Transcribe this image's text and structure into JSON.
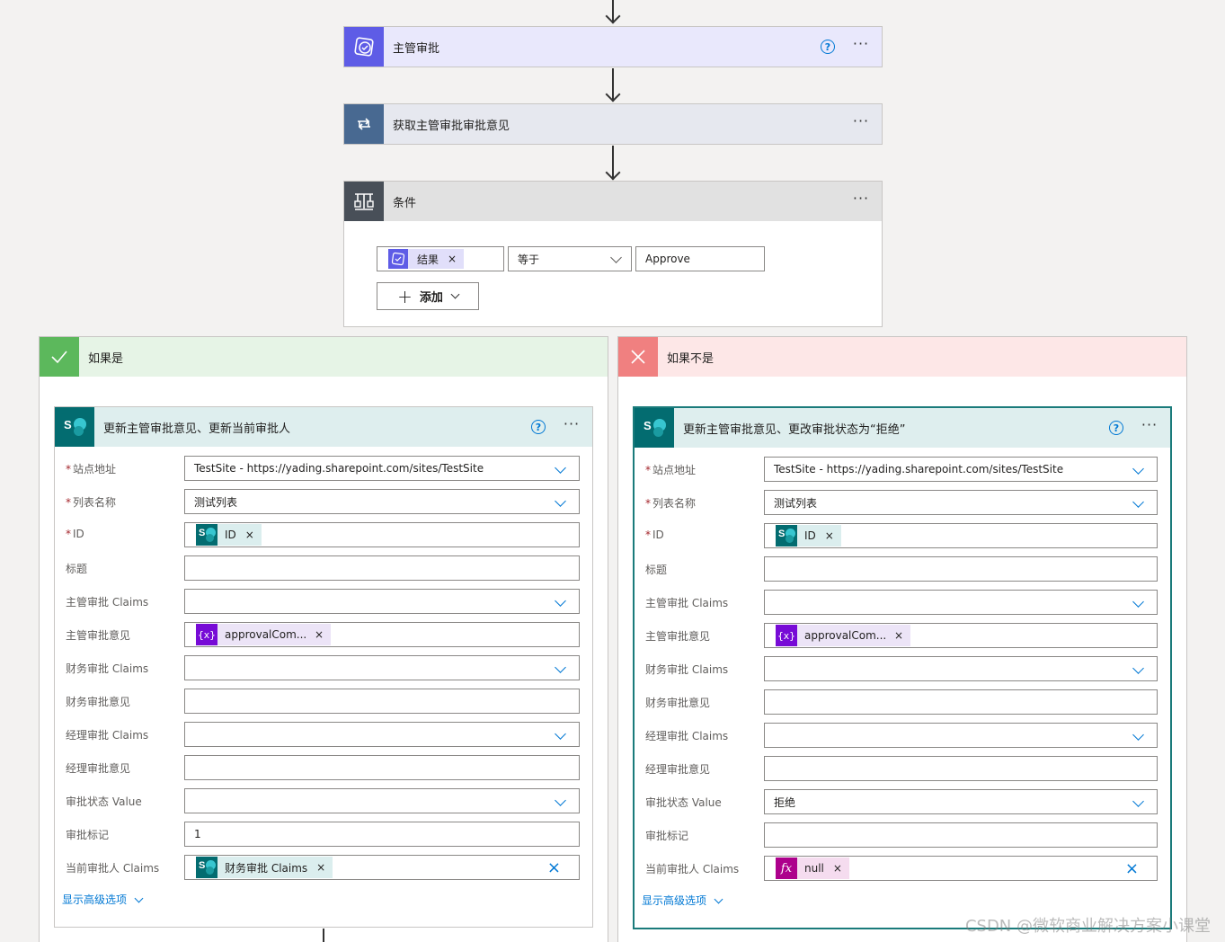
{
  "flow": {
    "step1": {
      "title": "主管审批",
      "icon": "approval-icon",
      "color": "#5e5ce6",
      "bg": "#e9e8fc"
    },
    "step2": {
      "title": "获取主管审批审批意见",
      "icon": "loop-icon",
      "color": "#486991",
      "bg": "#e6e8ef"
    },
    "condition": {
      "title": "条件",
      "icon": "condition-icon",
      "color": "#484f58",
      "bg": "#e1e1e1",
      "left_token": "结果",
      "operator": "等于",
      "right_value": "Approve",
      "add_label": "添加"
    }
  },
  "yes_branch": {
    "title": "如果是",
    "accent": "#5cb85c",
    "action": {
      "title": "更新主管审批意见、更新当前审批人",
      "fields": [
        {
          "label": "站点地址",
          "required": true,
          "value": "TestSite - https://yading.sharepoint.com/sites/TestSite",
          "type": "dropdown"
        },
        {
          "label": "列表名称",
          "required": true,
          "value": "测试列表",
          "type": "dropdown"
        },
        {
          "label": "ID",
          "required": true,
          "token": "ID",
          "token_kind": "sharepoint",
          "type": "token"
        },
        {
          "label": "标题",
          "required": false,
          "value": "",
          "type": "text"
        },
        {
          "label": "主管审批 Claims",
          "required": false,
          "value": "",
          "type": "dropdown"
        },
        {
          "label": "主管审批意见",
          "required": false,
          "token": "approvalCom...",
          "token_kind": "variable",
          "type": "token"
        },
        {
          "label": "财务审批 Claims",
          "required": false,
          "value": "",
          "type": "dropdown"
        },
        {
          "label": "财务审批意见",
          "required": false,
          "value": "",
          "type": "text"
        },
        {
          "label": "经理审批 Claims",
          "required": false,
          "value": "",
          "type": "dropdown"
        },
        {
          "label": "经理审批意见",
          "required": false,
          "value": "",
          "type": "text"
        },
        {
          "label": "审批状态 Value",
          "required": false,
          "value": "",
          "type": "dropdown"
        },
        {
          "label": "审批标记",
          "required": false,
          "value": "1",
          "type": "text"
        },
        {
          "label": "当前审批人 Claims",
          "required": false,
          "token": "财务审批 Claims",
          "token_kind": "sharepoint",
          "type": "token-clear"
        }
      ],
      "advanced_link": "显示高级选项"
    }
  },
  "no_branch": {
    "title": "如果不是",
    "accent": "#f08080",
    "action": {
      "title": "更新主管审批意见、更改审批状态为“拒绝”",
      "fields": [
        {
          "label": "站点地址",
          "required": true,
          "value": "TestSite - https://yading.sharepoint.com/sites/TestSite",
          "type": "dropdown"
        },
        {
          "label": "列表名称",
          "required": true,
          "value": "测试列表",
          "type": "dropdown"
        },
        {
          "label": "ID",
          "required": true,
          "token": "ID",
          "token_kind": "sharepoint",
          "type": "token"
        },
        {
          "label": "标题",
          "required": false,
          "value": "",
          "type": "text"
        },
        {
          "label": "主管审批 Claims",
          "required": false,
          "value": "",
          "type": "dropdown"
        },
        {
          "label": "主管审批意见",
          "required": false,
          "token": "approvalCom...",
          "token_kind": "variable",
          "type": "token"
        },
        {
          "label": "财务审批 Claims",
          "required": false,
          "value": "",
          "type": "dropdown"
        },
        {
          "label": "财务审批意见",
          "required": false,
          "value": "",
          "type": "text"
        },
        {
          "label": "经理审批 Claims",
          "required": false,
          "value": "",
          "type": "dropdown"
        },
        {
          "label": "经理审批意见",
          "required": false,
          "value": "",
          "type": "text"
        },
        {
          "label": "审批状态 Value",
          "required": false,
          "value": "拒绝",
          "type": "dropdown"
        },
        {
          "label": "审批标记",
          "required": false,
          "value": "",
          "type": "text"
        },
        {
          "label": "当前审批人 Claims",
          "required": false,
          "token": "null",
          "token_kind": "expression",
          "type": "token-clear"
        }
      ],
      "advanced_link": "显示高级选项"
    }
  },
  "watermark": "CSDN @微软商业解决方案小课堂"
}
